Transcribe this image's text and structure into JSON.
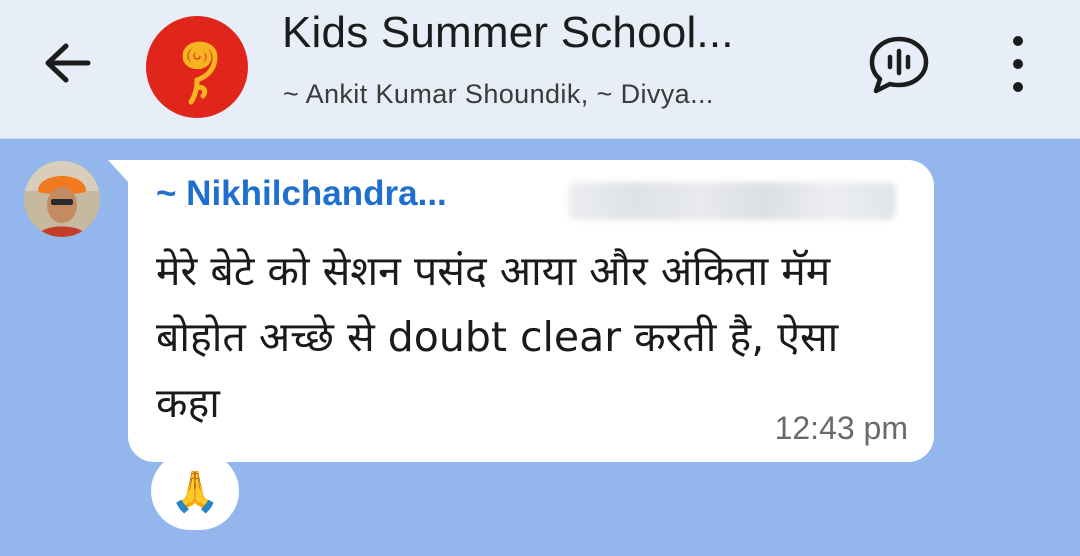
{
  "header": {
    "title": "Kids Summer School...",
    "subtitle": "~ Ankit Kumar Shoundik, ~ Divya...",
    "icons": {
      "back": "arrow-left-icon",
      "voice_chat": "voice-chat-icon",
      "more": "more-vertical-icon"
    },
    "colors": {
      "background": "#e8eef7",
      "avatar": "#e0251b"
    }
  },
  "chat": {
    "background": "#93b7ec",
    "message": {
      "sender_name": "~ Nikhilchandra...",
      "text": "मेरे बेटे को सेशन पसंद आया और अंकिता मॅम बोहोत अच्छे से doubt clear करती है, ऐसा कहा",
      "time": "12:43 pm",
      "reaction": "🙏",
      "colors": {
        "sender_name": "#1f6fcf",
        "bubble": "#ffffff"
      }
    }
  }
}
